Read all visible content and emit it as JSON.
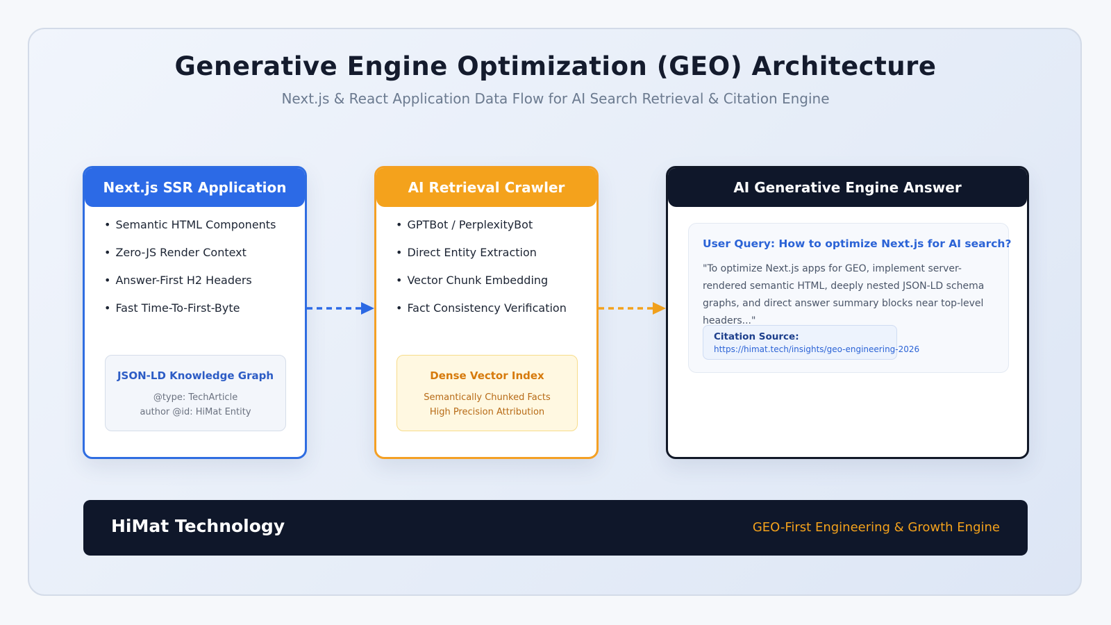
{
  "header": {
    "title": "Generative Engine Optimization (GEO) Architecture",
    "subtitle": "Next.js & React Application Data Flow for AI Search Retrieval & Citation Engine"
  },
  "cards": {
    "nextjs": {
      "title": "Next.js SSR Application",
      "bullets": [
        "Semantic HTML Components",
        "Zero-JS Render Context",
        "Answer-First H2 Headers",
        "Fast Time-To-First-Byte"
      ],
      "box": {
        "title": "JSON-LD Knowledge Graph",
        "lines": [
          "@type: TechArticle",
          "author @id: HiMat Entity"
        ]
      }
    },
    "crawler": {
      "title": "AI Retrieval Crawler",
      "bullets": [
        "GPTBot / PerplexityBot",
        "Direct Entity Extraction",
        "Vector Chunk Embedding",
        "Fact Consistency Verification"
      ],
      "box": {
        "title": "Dense Vector Index",
        "lines": [
          "Semantically Chunked Facts",
          "High Precision Attribution"
        ]
      }
    },
    "answer": {
      "title": "AI Generative Engine Answer",
      "query": "User Query: How to optimize Next.js for AI search?",
      "quote": "\"To optimize Next.js apps for GEO, implement server-rendered semantic HTML, deeply nested JSON-LD schema graphs, and direct answer summary blocks near top-level headers...\"",
      "citation_label": "Citation Source:",
      "citation_url": "https://himat.tech/insights/geo-engineering-2026"
    }
  },
  "footer": {
    "brand": "HiMat Technology",
    "tagline": "GEO-First Engineering & Growth Engine"
  },
  "colors": {
    "blue": "#2c6ae6",
    "orange": "#f4a21c",
    "navy": "#0f172a"
  }
}
